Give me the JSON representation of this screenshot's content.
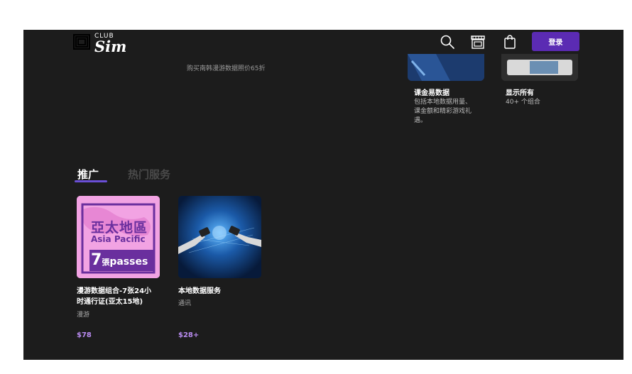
{
  "header": {
    "logo_small": "CLUB",
    "logo_main": "Sim",
    "login_label": "登录"
  },
  "top_section": {
    "caption": "购买南韩漫游数据照价65折",
    "cards": [
      {
        "title": "课金易数据",
        "desc_lines": [
          "包括本地数据用量、",
          "课金额和精彩游戏礼",
          "遇。"
        ]
      },
      {
        "title": "显示所有",
        "desc_lines": [
          "40+ 个组合"
        ]
      }
    ]
  },
  "tabs": [
    {
      "label": "推广",
      "active": true
    },
    {
      "label": "热门服务",
      "active": false
    }
  ],
  "products": [
    {
      "image_text_cn": "亞太地區",
      "image_text_en": "Asia Pacific",
      "image_number": "7",
      "image_unit_cn": "張",
      "image_unit_en": "passes",
      "name_lines": [
        "漫游数据组合-7张24小",
        "时通行证(亚太15地)"
      ],
      "category": "漫游",
      "price": "$78"
    },
    {
      "name_lines": [
        "本地数据服务"
      ],
      "category": "通讯",
      "price": "$28+"
    }
  ],
  "colors": {
    "background": "#1c1c1c",
    "accent": "#5b2bb3",
    "price": "#b98bf0",
    "promo_card": "#f2a3e3"
  },
  "icons": [
    "search-icon",
    "store-icon",
    "shopping-bag-icon"
  ]
}
